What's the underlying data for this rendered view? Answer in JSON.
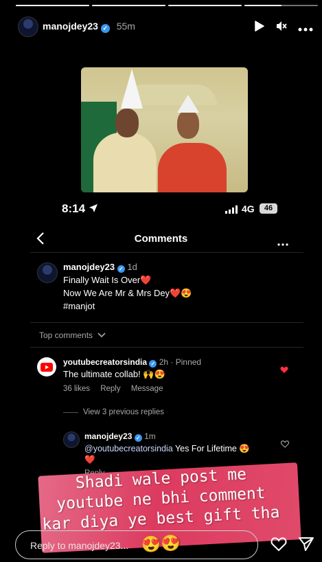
{
  "story": {
    "progress": [
      1,
      1,
      1,
      0.5
    ],
    "username": "manojdey23",
    "time_ago": "55m"
  },
  "screenshot": {
    "status_time": "8:14",
    "network": "4G",
    "battery": "46",
    "title": "Comments",
    "post": {
      "username": "manojdey23",
      "time": "1d",
      "line1": "Finally Wait Is Over❤️",
      "line2": "Now We Are Mr & Mrs Dey❤️😍",
      "line3": "#manjot"
    },
    "top_comments_label": "Top comments",
    "comment": {
      "username": "youtubecreatorsindia",
      "meta": "2h · Pinned",
      "text": "The ultimate collab! 🙌😍",
      "likes": "36 likes",
      "reply": "Reply",
      "message": "Message"
    },
    "view_replies": "View 3 previous replies",
    "reply": {
      "username": "manojdey23",
      "time": "1m",
      "mention": "@youtubecreatorsindia",
      "text": " Yes For Lifetime 😍",
      "heart": "❤️",
      "reply_label": "Reply"
    }
  },
  "caption": {
    "line1": "Shadi wale post me",
    "line2": "youtube ne bhi comment",
    "line3": "kar diya ye best gift tha",
    "line4": "😍😍"
  },
  "footer": {
    "reply_placeholder": "Reply to manojdey23..."
  },
  "colors": {
    "verified": "#3897f0",
    "caption_bg": "#dc3b5f",
    "heart": "#ff3040"
  }
}
